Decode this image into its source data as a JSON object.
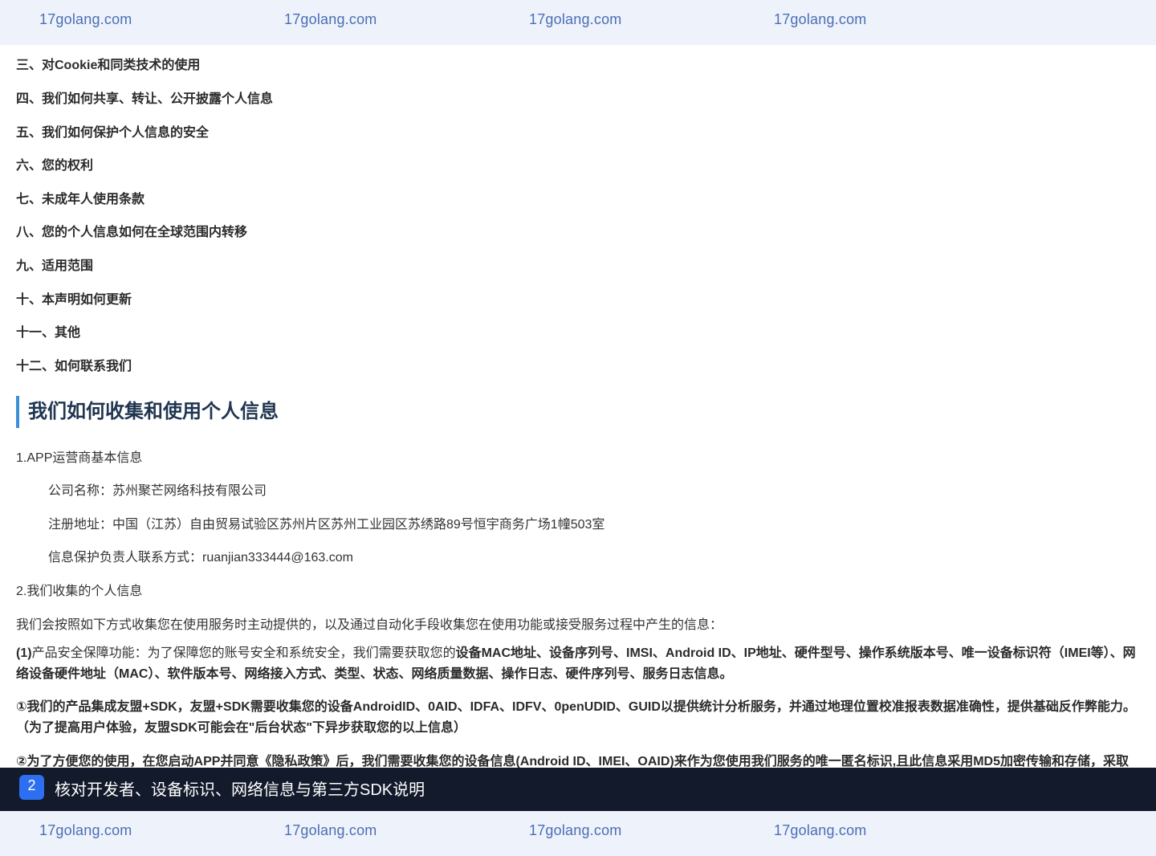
{
  "watermark": {
    "text": "17golang.com"
  },
  "toc": {
    "items": [
      "三、对Cookie和同类技术的使用",
      "四、我们如何共享、转让、公开披露个人信息",
      "五、我们如何保护个人信息的安全",
      "六、您的权利",
      "七、未成年人使用条款",
      "八、您的个人信息如何在全球范围内转移",
      "九、适用范围",
      "十、本声明如何更新",
      "十一、其他",
      "十二、如何联系我们"
    ]
  },
  "section": {
    "heading": "我们如何收集和使用个人信息",
    "p1_title": "1.APP运营商基本信息",
    "company_name": "公司名称：苏州聚芒网络科技有限公司",
    "address": "注册地址：中国（江苏）自由贸易试验区苏州片区苏州工业园区苏绣路89号恒宇商务广场1幢503室",
    "contact": "信息保护负责人联系方式：ruanjian333444@163.com",
    "p2_title": "2.我们收集的个人信息",
    "intro": "我们会按照如下方式收集您在使用服务时主动提供的，以及通过自动化手段收集您在使用功能或接受服务过程中产生的信息：",
    "item1_prefix": "(1)",
    "item1_plain": "产品安全保障功能：为了保障您的账号安全和系统安全，我们需要获取您的",
    "item1_bold": "设备MAC地址、设备序列号、IMSI、Android ID、IP地址、硬件型号、操作系统版本号、唯一设备标识符（IMEI等）、网络设备硬件地址（MAC）、软件版本号、网络接入方式、类型、状态、网络质量数据、操作日志、硬件序列号、服务日志信息。",
    "item2": "①我们的产品集成友盟+SDK，友盟+SDK需要收集您的设备AndroidID、0AID、IDFA、IDFV、0penUDID、GUID以提供统计分析服务，并通过地理位置校准报表数据准确性，提供基础反作弊能力。（为了提高用户体验，友盟SDK可能会在\"后台状态\"下异步获取您的以上信息）",
    "item3": "②为了方便您的使用，在您启动APP并同意《隐私政策》后，我们需要收集您的设备信息(Android ID、IMEI、OAID)来作为您使用我们服务的唯一匿名标识,且此信息采用MD5加密传输和存储，采取"
  },
  "bottom_bar": {
    "step": "2",
    "text": "核对开发者、设备标识、网络信息与第三方SDK说明"
  }
}
